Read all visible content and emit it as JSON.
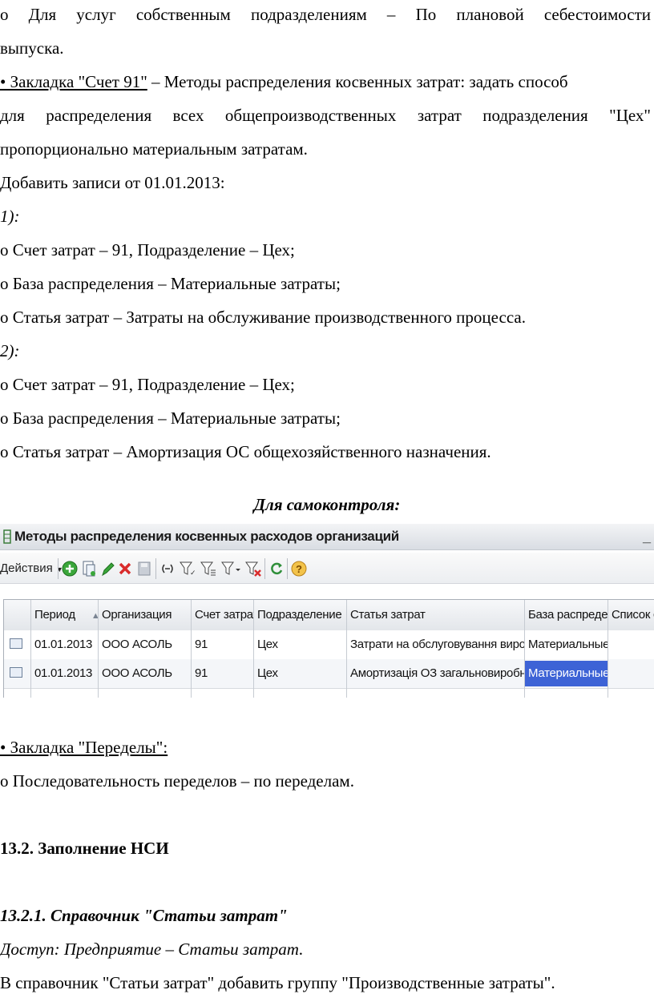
{
  "lines": {
    "l1": "o Для услуг собственным подразделениям – По плановой себестоимости",
    "l2": "выпуска.",
    "l3_link": "• Закладка \"Счет 91\"",
    "l3_rest": " – Методы распределения косвенных затрат: задать способ",
    "l4": "для распределения всех общепроизводственных затрат подразделения \"Цех\"",
    "l5": "пропорционально материальным затратам.",
    "l6": "Добавить записи от 01.01.2013:",
    "l7": "1):",
    "l8": "o Счет затрат – 91, Подразделение – Цех;",
    "l9": "o База распределения – Материальные затраты;",
    "l10": "o Статья затрат – Затраты на обслуживание производственного процесса.",
    "l11": "2):",
    "l12": "o Счет затрат – 91, Подразделение – Цех;",
    "l13": "o База распределения – Материальные затраты;",
    "l14": "o Статья затрат – Амортизация ОС общехозяйственного назначения.",
    "self_control": "Для самоконтроля:",
    "l15_link": "• Закладка \"Переделы\":",
    "l16": "o Последовательность переделов – по переделам.",
    "h1": "13.2. Заполнение НСИ",
    "h2": "13.2.1. Справочник \"Статьи затрат\"",
    "access": "Доступ: Предприятие – Статьи затрат.",
    "l17": "В справочник \"Статьи затрат\" добавить группу \"Производственные затраты\"."
  },
  "window": {
    "title": "Методы распределения косвенных расходов организаций",
    "minimize": "_",
    "actions_label": "Действия",
    "icons": [
      "add-icon",
      "copy-icon",
      "edit-icon",
      "delete-icon",
      "save-icon",
      "range-icon",
      "filter-icon",
      "filter-list-icon",
      "filter-menu-icon",
      "filter-clear-icon",
      "refresh-icon",
      "help-icon"
    ],
    "colors": {
      "selection": "#3d63d6",
      "add": "#3aa63a",
      "delete": "#d92b2b",
      "refresh": "#2f8f3a",
      "help": "#e8a21a"
    }
  },
  "table": {
    "headers": [
      "Период",
      "Организация",
      "Счет затрат",
      "Подразделение",
      "Статья затрат",
      "База распреде...",
      "Список с"
    ],
    "rows": [
      [
        "01.01.2013",
        "ООО АСОЛЬ",
        "91",
        "Цех",
        "Затрати на обслуговування виробнич...",
        "Материальные ..."
      ],
      [
        "01.01.2013",
        "ООО АСОЛЬ",
        "91",
        "Цех",
        "Амортизація ОЗ загальновиробничог...",
        "Материальные ..."
      ]
    ]
  }
}
